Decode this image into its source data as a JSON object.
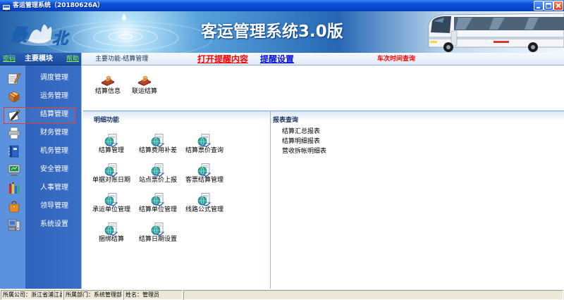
{
  "window": {
    "title": "客运管理系统（20180626A）"
  },
  "banner": {
    "logo_chars": {
      "first": "最",
      "second": "北"
    },
    "title": "客运管理系统3.0版"
  },
  "sidebar": {
    "password_link": "密码",
    "title": "主要模块",
    "help_link": "帮助",
    "items": [
      {
        "label": "调度管理",
        "icon": "notebook-pen-icon"
      },
      {
        "label": "运务管理",
        "icon": "package-icon"
      },
      {
        "label": "结算管理",
        "icon": "pen-paper-icon",
        "selected": true
      },
      {
        "label": "财务管理",
        "icon": "printer-icon"
      },
      {
        "label": "机务管理",
        "icon": "binder-icon"
      },
      {
        "label": "安全管理",
        "icon": "monitor-icon"
      },
      {
        "label": "人事管理",
        "icon": "crayons-icon"
      },
      {
        "label": "领导管理",
        "icon": "bag-icon"
      },
      {
        "label": "系统设置",
        "icon": "computer-settings-icon"
      }
    ]
  },
  "main": {
    "breadcrumb": "主要功能-结算管理",
    "links": {
      "open_reminders": "打开提醒内容",
      "reminder_settings": "提醒设置",
      "trip_time_query": "车次时间查询"
    },
    "top_functions": [
      {
        "label": "结算信息",
        "icon": "stamp-icon"
      },
      {
        "label": "联运结算",
        "icon": "stamp-icon"
      }
    ],
    "detail_section": {
      "title": "明细功能",
      "item_icon": "document-globe-icon",
      "items": [
        {
          "label": "结算管理"
        },
        {
          "label": "结算费用补差"
        },
        {
          "label": "结算票价查询"
        },
        {
          "label": "单据对账日期"
        },
        {
          "label": "站点票价上报"
        },
        {
          "label": "客票结算管理"
        },
        {
          "label": "承运单位管理"
        },
        {
          "label": "结算单位管理"
        },
        {
          "label": "线路公式管理"
        },
        {
          "label": "捆绑结算"
        },
        {
          "label": "结算日期设置"
        }
      ]
    },
    "report_section": {
      "title": "报表查询",
      "items": [
        "结算汇总报表",
        "结算明细报表",
        "营收拆帐明细表"
      ]
    }
  },
  "status_bar": {
    "company": "所属公司：浙江省浦江县汽",
    "department": "所属部门：系统管理部",
    "user": "姓名：管理员"
  },
  "colors": {
    "title_bar": "#0a4fd9",
    "sidebar": "#2f63bd",
    "sidebar_icon_column": "#5c92dd",
    "sidebar_header": "#1c4a9c",
    "selected_outline": "#e53a2f",
    "sidebar_link": "#7cff3a",
    "red_link": "#ff0000",
    "blue_link": "#0a14d8",
    "section_header": "#dbe7f6",
    "status_bar": "#ece9d8"
  }
}
